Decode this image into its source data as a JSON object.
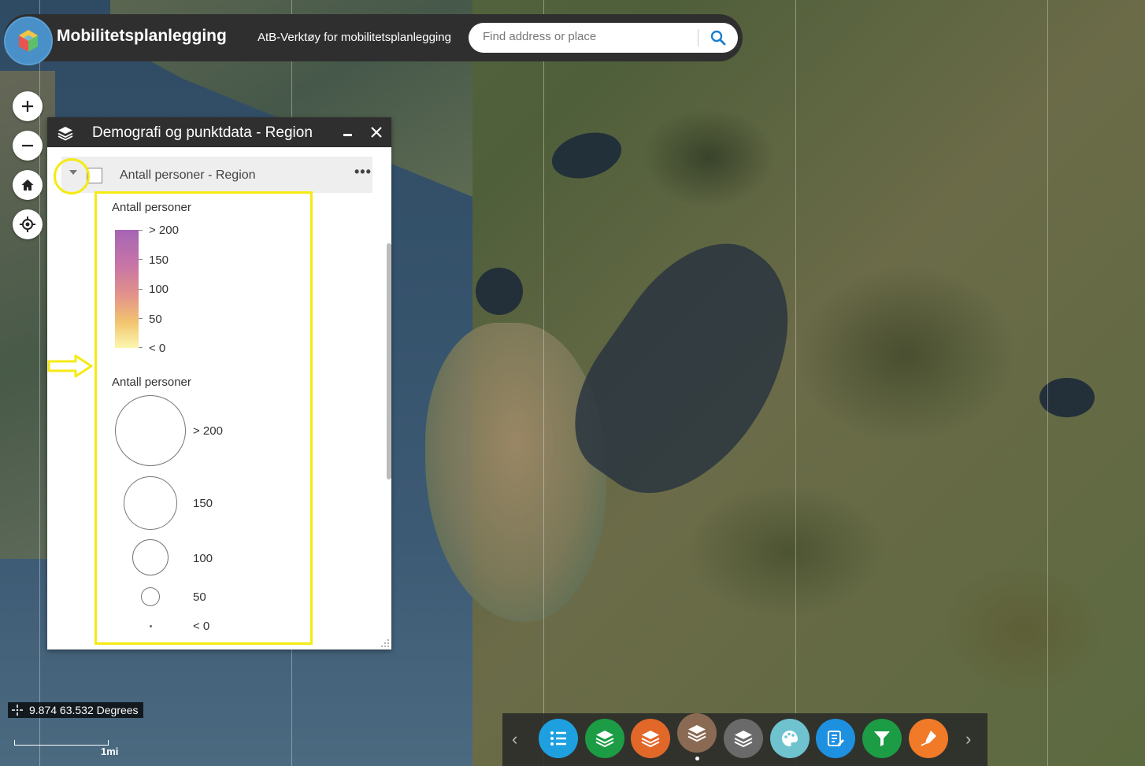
{
  "app": {
    "title": "Mobilitetsplanlegging",
    "subtitle": "AtB-Verktøy for mobilitetsplanlegging"
  },
  "search": {
    "placeholder": "Find address or place"
  },
  "map_controls": [
    {
      "name": "zoom-in",
      "icon": "plus-icon"
    },
    {
      "name": "zoom-out",
      "icon": "minus-icon"
    },
    {
      "name": "home",
      "icon": "home-icon"
    },
    {
      "name": "locate",
      "icon": "locate-icon"
    }
  ],
  "panel": {
    "title": "Demografi og punktdata - Region",
    "layer": {
      "label": "Antall personer - Region"
    },
    "color_legend": {
      "title": "Antall personer",
      "labels": [
        "> 200",
        "150",
        "100",
        "50",
        "< 0"
      ],
      "colors": [
        "#a565b5",
        "#c775a6",
        "#e3928a",
        "#f2c470",
        "#fbf7ae"
      ]
    },
    "size_legend": {
      "title": "Antall personer",
      "labels": [
        "> 200",
        "150",
        "100",
        "50",
        "< 0"
      ]
    }
  },
  "coordinates": "9.874 63.532 Degrees",
  "scale": {
    "label": "1mi"
  },
  "dock": {
    "buttons": [
      {
        "name": "legend",
        "icon": "list-icon",
        "color": "#1ea0e0"
      },
      {
        "name": "layers-green",
        "icon": "layers-icon",
        "color": "#1c9c44"
      },
      {
        "name": "layers-orange",
        "icon": "layers-icon",
        "color": "#e2682a"
      },
      {
        "name": "layers-brown",
        "icon": "layers-icon",
        "color": "#8a6a52"
      },
      {
        "name": "layers-gray",
        "icon": "layers-icon",
        "color": "#6a6a6a"
      },
      {
        "name": "basemap",
        "icon": "palette-icon",
        "color": "#6ec3cf"
      },
      {
        "name": "edit",
        "icon": "edit-icon",
        "color": "#1e90e0"
      },
      {
        "name": "filter",
        "icon": "filter-icon",
        "color": "#1c9c44"
      },
      {
        "name": "draw",
        "icon": "draw-icon",
        "color": "#f07a28"
      }
    ]
  },
  "highlight_color": "#f5ea14"
}
